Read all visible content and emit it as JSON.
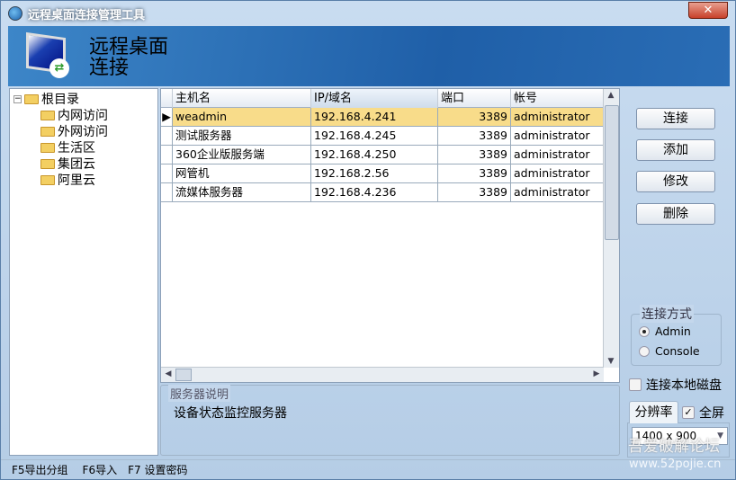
{
  "window": {
    "title": "远程桌面连接管理工具",
    "close": "✕"
  },
  "banner": {
    "line1": "远程桌面",
    "line2": "连接"
  },
  "tree": {
    "root": "根目录",
    "children": [
      "内网访问",
      "外网访问",
      "生活区",
      "集团云",
      "阿里云"
    ]
  },
  "grid": {
    "columns": [
      "主机名",
      "IP/域名",
      "端口",
      "帐号"
    ],
    "rows": [
      {
        "host": "weadmin",
        "ip": "192.168.4.241",
        "port": "3389",
        "account": "administrator",
        "selected": true
      },
      {
        "host": "测试服务器",
        "ip": "192.168.4.245",
        "port": "3389",
        "account": "administrator"
      },
      {
        "host": "360企业版服务端",
        "ip": "192.168.4.250",
        "port": "3389",
        "account": "administrator"
      },
      {
        "host": "网管机",
        "ip": "192.168.2.56",
        "port": "3389",
        "account": "administrator"
      },
      {
        "host": "流媒体服务器",
        "ip": "192.168.4.236",
        "port": "3389",
        "account": "administrator"
      }
    ]
  },
  "description": {
    "legend": "服务器说明",
    "text": "设备状态监控服务器"
  },
  "buttons": {
    "connect": "连接",
    "add": "添加",
    "edit": "修改",
    "delete": "删除"
  },
  "connect_mode": {
    "legend": "连接方式",
    "options": [
      "Admin",
      "Console"
    ],
    "selected": "Admin"
  },
  "local_disk": {
    "label": "连接本地磁盘",
    "checked": false
  },
  "resolution": {
    "tab": "分辨率",
    "fullscreen_label": "全屏",
    "fullscreen_checked": true,
    "value": "1400 x 900"
  },
  "status": {
    "items": [
      "F5导出分组",
      "F6导入",
      "F7 设置密码"
    ]
  },
  "watermark": {
    "line1": "吾爱破解论坛",
    "line2": "www.52pojie.cn"
  }
}
